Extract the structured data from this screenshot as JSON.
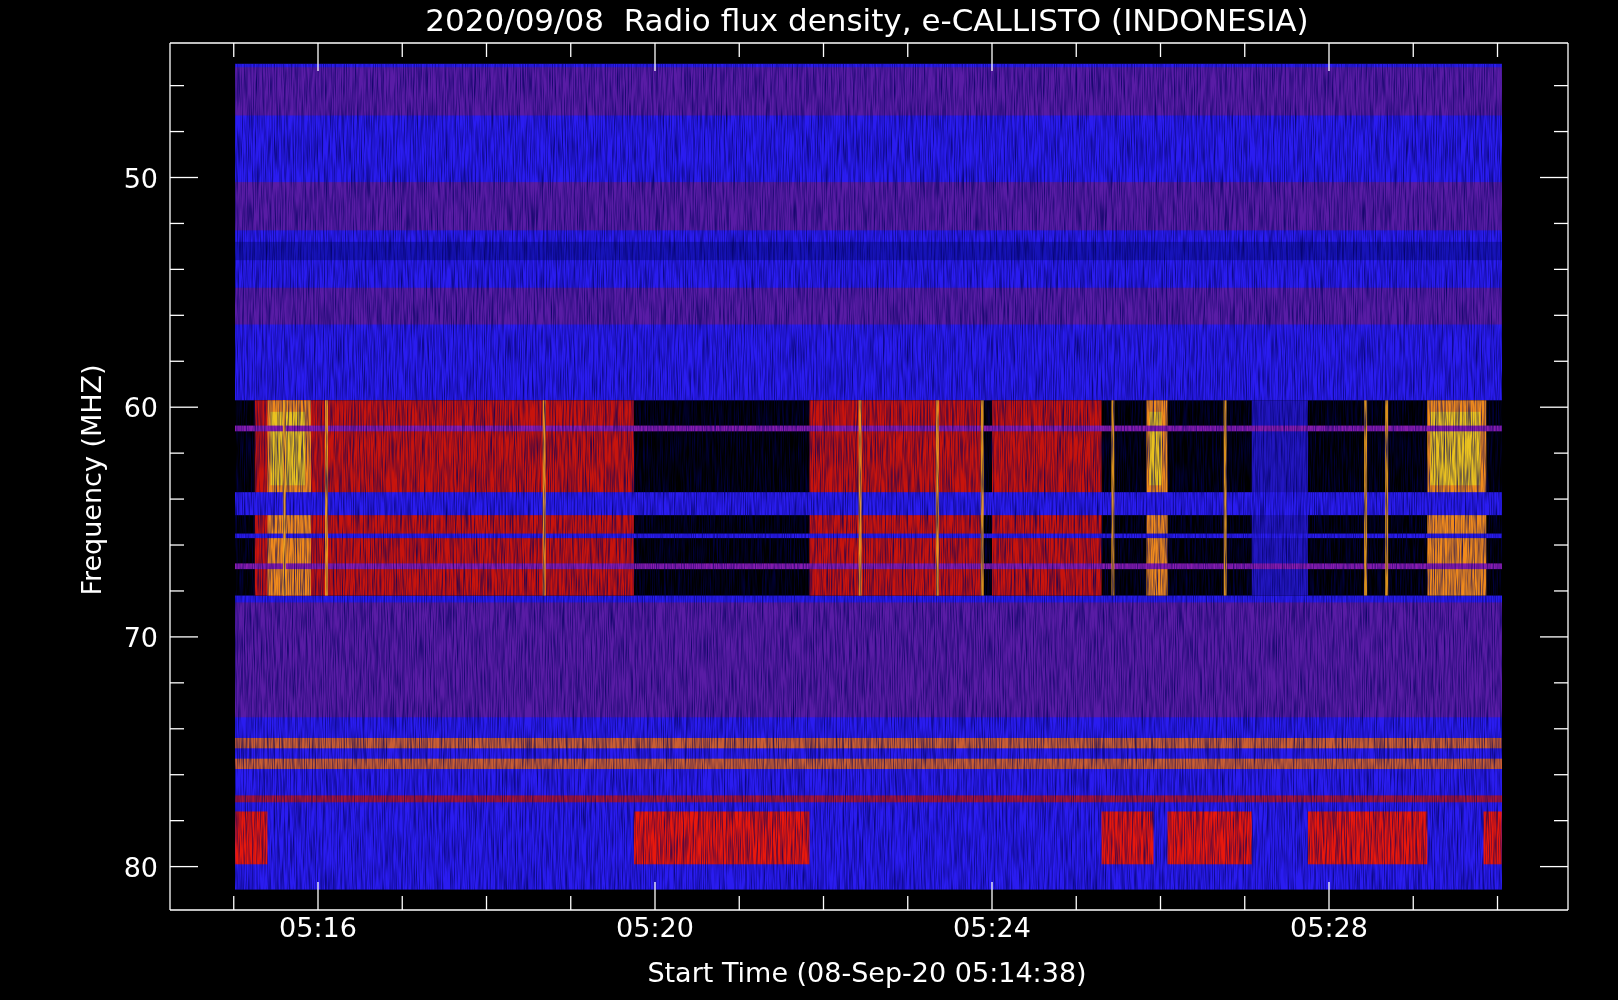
{
  "title": "2020/09/08  Radio flux density, e-CALLISTO (INDONESIA)",
  "x_axis": {
    "label": "Start Time (08-Sep-20 05:14:38)",
    "ticks": [
      "05:16",
      "05:20",
      "05:24",
      "05:28"
    ]
  },
  "y_axis": {
    "label": "Frequency (MHZ)",
    "ticks": [
      "50",
      "60",
      "70",
      "80"
    ]
  }
}
